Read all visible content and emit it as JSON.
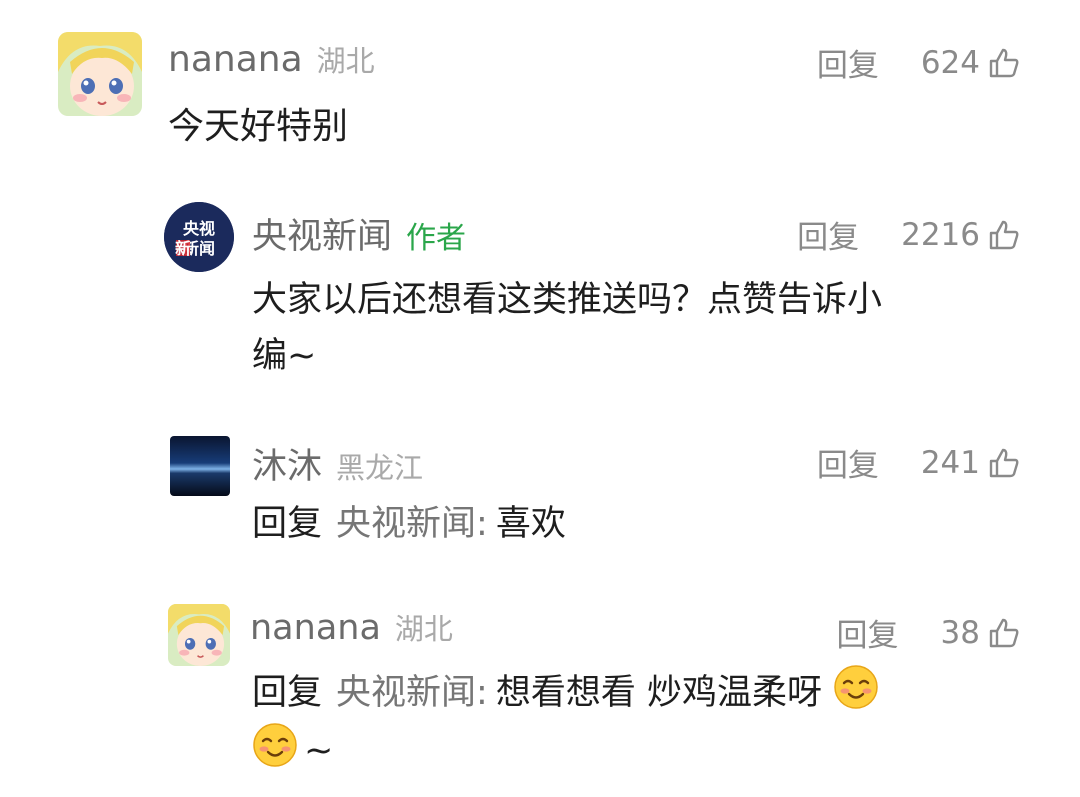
{
  "comments": [
    {
      "username": "nanana",
      "location": "湖北",
      "reply_label": "回复",
      "likes": "624",
      "text": "今天好特别"
    },
    {
      "username": "央视新闻",
      "author_tag": "作者",
      "avatar_text_top": "央视",
      "avatar_text_bottom": "新闻",
      "reply_label": "回复",
      "likes": "2216",
      "text_line1": "大家以后还想看这类推送吗？点赞告诉小",
      "text_line2": "编~"
    },
    {
      "username": "沐沐",
      "location": "黑龙江",
      "reply_label": "回复",
      "likes": "241",
      "reply_prefix": "回复",
      "reply_target": "央视新闻",
      "colon": ":",
      "text": "喜欢"
    },
    {
      "username": "nanana",
      "location": "湖北",
      "reply_label": "回复",
      "likes": "38",
      "reply_prefix": "回复",
      "reply_target": "央视新闻",
      "colon": ":",
      "text_line1": "想看想看 炒鸡温柔呀",
      "text_line2_suffix": "~"
    }
  ],
  "colors": {
    "author_tag": "#2aa64a",
    "avatar_news_bg": "#1b2a5c",
    "avatar_news_red": "#d8232a"
  },
  "icons": {
    "like": "thumbs-up-outline-icon",
    "emoji": "smiling-face-emoji"
  }
}
